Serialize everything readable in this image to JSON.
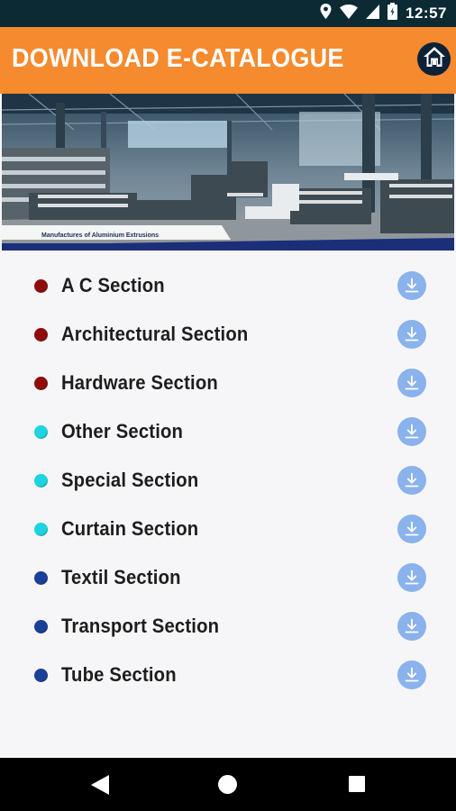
{
  "status_bar": {
    "time": "12:57",
    "icons": [
      "location-icon",
      "wifi-icon",
      "signal-icon",
      "battery-icon"
    ]
  },
  "app_bar": {
    "title": "DOWNLOAD E-CATALOGUE",
    "home_icon": "home-icon",
    "background": "#f58a2e"
  },
  "banner": {
    "caption": "Manufactures of Aluminium Extrusions"
  },
  "sections": [
    {
      "label": "A C Section",
      "bullet_color": "#8e0c0c"
    },
    {
      "label": "Architectural Section",
      "bullet_color": "#8e0c0c"
    },
    {
      "label": "Hardware Section",
      "bullet_color": "#8e0c0c"
    },
    {
      "label": "Other Section",
      "bullet_color": "#1ed4e0"
    },
    {
      "label": "Special Section",
      "bullet_color": "#1ed4e0"
    },
    {
      "label": "Curtain Section",
      "bullet_color": "#1ed4e0"
    },
    {
      "label": "Textil Section",
      "bullet_color": "#1a3f98"
    },
    {
      "label": "Transport Section",
      "bullet_color": "#1a3f98"
    },
    {
      "label": "Tube Section",
      "bullet_color": "#1a3f98"
    }
  ],
  "download_icon": "download-icon",
  "nav_bar": {
    "icons": [
      "back-icon",
      "home-circle-icon",
      "recent-apps-icon"
    ]
  }
}
